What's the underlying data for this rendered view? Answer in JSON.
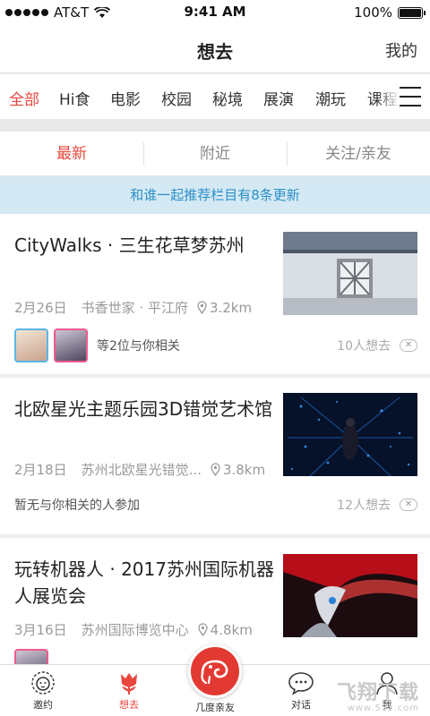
{
  "status_bar": {
    "carrier": "AT&T",
    "time": "9:41 AM",
    "battery": "100%",
    "battery_level": 1.0
  },
  "navbar": {
    "title": "想去",
    "right_link": "我的"
  },
  "categories": {
    "items": [
      {
        "label": "全部",
        "active": true
      },
      {
        "label": "Hi食"
      },
      {
        "label": "电影"
      },
      {
        "label": "校园"
      },
      {
        "label": "秘境"
      },
      {
        "label": "展演"
      },
      {
        "label": "潮玩"
      },
      {
        "label": "课程"
      }
    ],
    "menu_icon": "hamburger-icon"
  },
  "subtabs": [
    {
      "label": "最新",
      "active": true
    },
    {
      "label": "附近"
    },
    {
      "label": "关注/亲友"
    }
  ],
  "notice": "和谁一起推荐栏目有8条更新",
  "cards": [
    {
      "title": "CityWalks · 三生花草梦苏州",
      "date": "2月26日",
      "place": "书香世家 · 平江府",
      "distance": "3.2km",
      "social_text": "等2位与你相关",
      "want": "10人想去",
      "dismiss": "✕"
    },
    {
      "title": "北欧星光主题乐园3D错觉艺术馆",
      "date": "2月18日",
      "place": "苏州北欧星光错觉...",
      "distance": "3.8km",
      "social_text": "暂无与你相关的人参加",
      "want": "12人想去",
      "dismiss": "✕"
    },
    {
      "title": "玩转机器人 · 2017苏州国际机器人展览会",
      "date": "3月16日",
      "place": "苏州国际博览中心",
      "distance": "4.8km"
    }
  ],
  "tabbar": {
    "items": [
      {
        "label": "邀约",
        "icon": "lion-icon"
      },
      {
        "label": "想去",
        "icon": "tulip-icon",
        "active": true
      },
      {
        "label": "几度亲友",
        "icon": "chameleon-icon"
      },
      {
        "label": "对话",
        "icon": "chat-bubble-icon"
      },
      {
        "label": "我",
        "icon": "person-icon"
      }
    ]
  },
  "watermark": {
    "text": "飞翔下载",
    "url": "www.52z.com"
  },
  "colors": {
    "accent": "#e8473e",
    "notice_bg": "#d4e9f4",
    "notice_text": "#2b8fc7"
  }
}
